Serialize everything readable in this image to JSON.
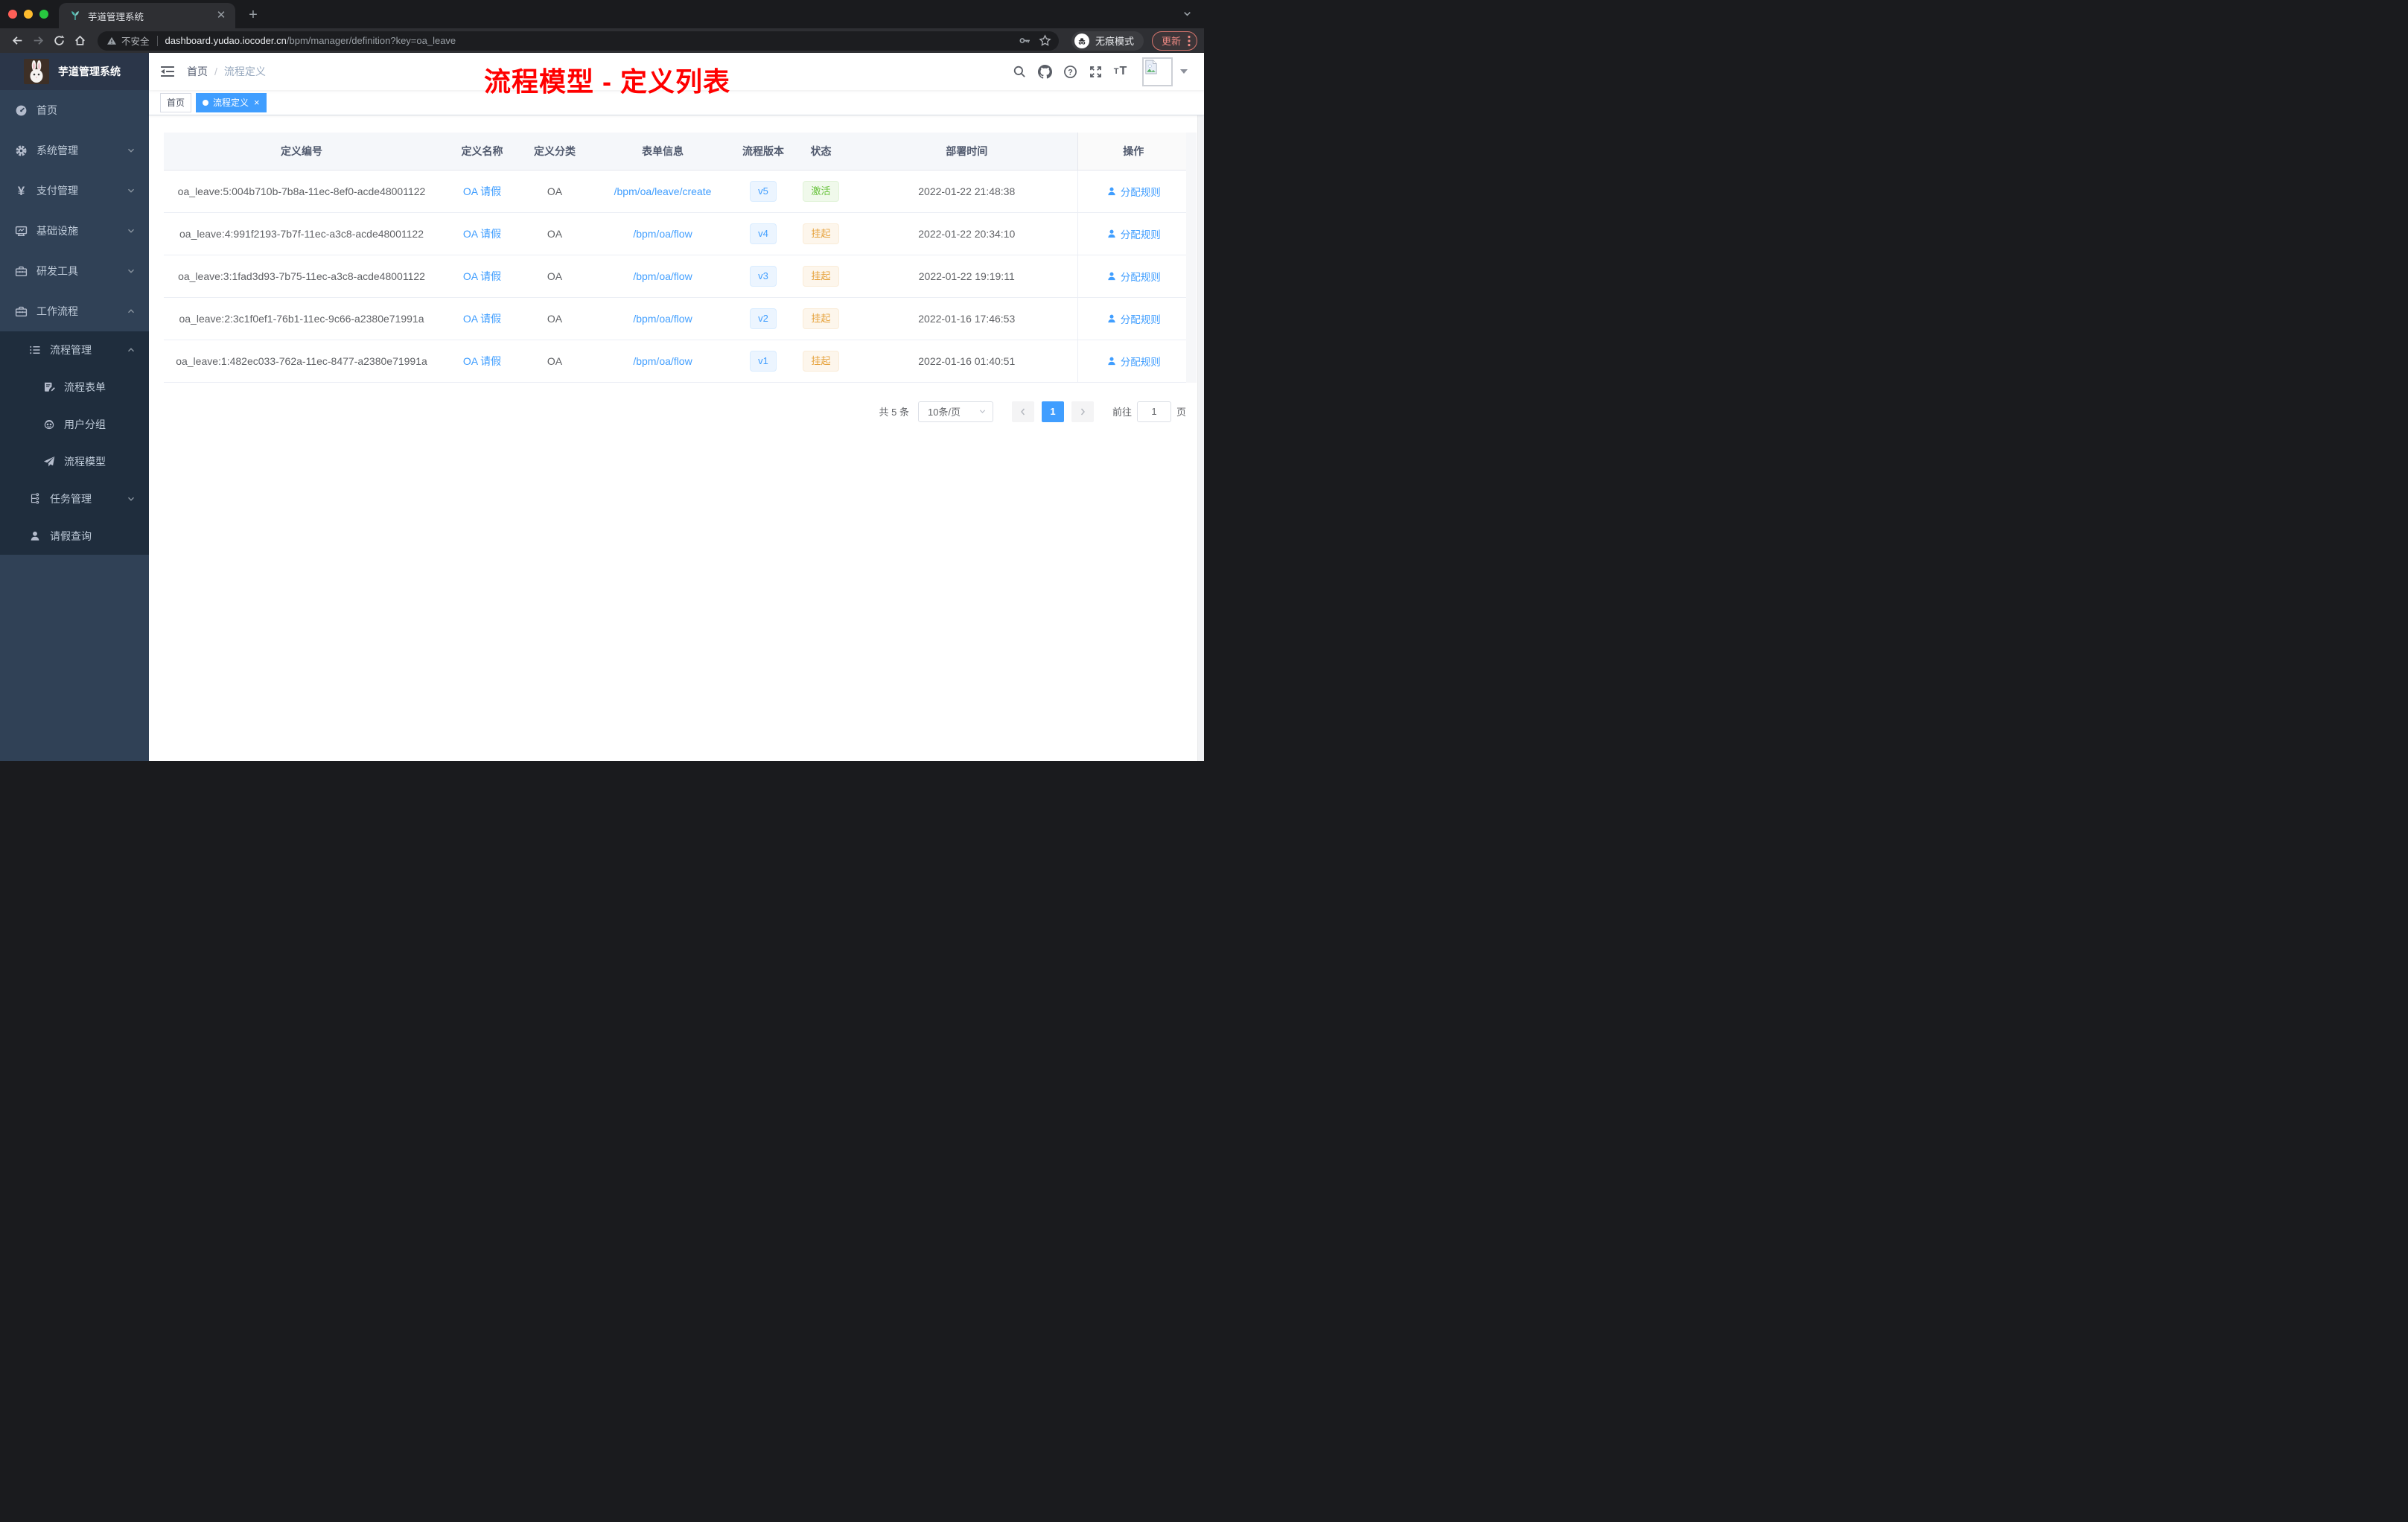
{
  "browser": {
    "tab": {
      "title": "芋道管理系统"
    },
    "toolbar": {
      "security_label": "不安全",
      "url_host": "dashboard.yudao.iocoder.cn",
      "url_path": "/bpm/manager/definition?key=oa_leave",
      "incognito_label": "无痕模式",
      "update_label": "更新"
    }
  },
  "sidebar": {
    "logo_title": "芋道管理系统",
    "menu": [
      {
        "label": "首页",
        "icon": "dashboard-icon"
      },
      {
        "label": "系统管理",
        "icon": "gear-icon"
      },
      {
        "label": "支付管理",
        "icon": "yen-icon"
      },
      {
        "label": "基础设施",
        "icon": "monitor-icon"
      },
      {
        "label": "研发工具",
        "icon": "toolbox-icon"
      },
      {
        "label": "工作流程",
        "icon": "briefcase-icon"
      }
    ],
    "submenu": [
      {
        "label": "流程管理",
        "icon": "list-tree-icon"
      },
      {
        "label": "流程表单",
        "icon": "form-icon"
      },
      {
        "label": "用户分组",
        "icon": "robot-icon"
      },
      {
        "label": "流程模型",
        "icon": "paper-plane-icon"
      },
      {
        "label": "任务管理",
        "icon": "org-tree-icon"
      },
      {
        "label": "请假查询",
        "icon": "user-icon"
      }
    ]
  },
  "navbar": {
    "breadcrumb": {
      "home": "首页",
      "separator": "/",
      "current": "流程定义"
    }
  },
  "annotation": {
    "text": "流程模型 - 定义列表",
    "color": "#ff0000"
  },
  "tags_view": {
    "home_tag": "首页",
    "active_tag": "流程定义"
  },
  "table": {
    "columns": [
      "定义编号",
      "定义名称",
      "定义分类",
      "表单信息",
      "流程版本",
      "状态",
      "部署时间",
      "操作"
    ],
    "action_label": "分配规则",
    "rows": [
      {
        "id": "oa_leave:5:004b710b-7b8a-11ec-8ef0-acde48001122",
        "name": "OA 请假",
        "category": "OA",
        "form": "/bpm/oa/leave/create",
        "version": "v5",
        "status": "激活",
        "status_type": "success",
        "deploy_time": "2022-01-22 21:48:38"
      },
      {
        "id": "oa_leave:4:991f2193-7b7f-11ec-a3c8-acde48001122",
        "name": "OA 请假",
        "category": "OA",
        "form": "/bpm/oa/flow",
        "version": "v4",
        "status": "挂起",
        "status_type": "warning",
        "deploy_time": "2022-01-22 20:34:10"
      },
      {
        "id": "oa_leave:3:1fad3d93-7b75-11ec-a3c8-acde48001122",
        "name": "OA 请假",
        "category": "OA",
        "form": "/bpm/oa/flow",
        "version": "v3",
        "status": "挂起",
        "status_type": "warning",
        "deploy_time": "2022-01-22 19:19:11"
      },
      {
        "id": "oa_leave:2:3c1f0ef1-76b1-11ec-9c66-a2380e71991a",
        "name": "OA 请假",
        "category": "OA",
        "form": "/bpm/oa/flow",
        "version": "v2",
        "status": "挂起",
        "status_type": "warning",
        "deploy_time": "2022-01-16 17:46:53"
      },
      {
        "id": "oa_leave:1:482ec033-762a-11ec-8477-a2380e71991a",
        "name": "OA 请假",
        "category": "OA",
        "form": "/bpm/oa/flow",
        "version": "v1",
        "status": "挂起",
        "status_type": "warning",
        "deploy_time": "2022-01-16 01:40:51"
      }
    ]
  },
  "pagination": {
    "total_label": "共 5 条",
    "page_size": "10条/页",
    "current_page": "1",
    "goto_label": "前往",
    "goto_value": "1",
    "unit_label": "页"
  },
  "colors": {
    "primary": "#409eff",
    "success": "#67c23a",
    "warning": "#e6a23c",
    "sidebar_bg": "#304156",
    "submenu_bg": "#1f2d3d",
    "annotation_red": "#ff0000"
  }
}
